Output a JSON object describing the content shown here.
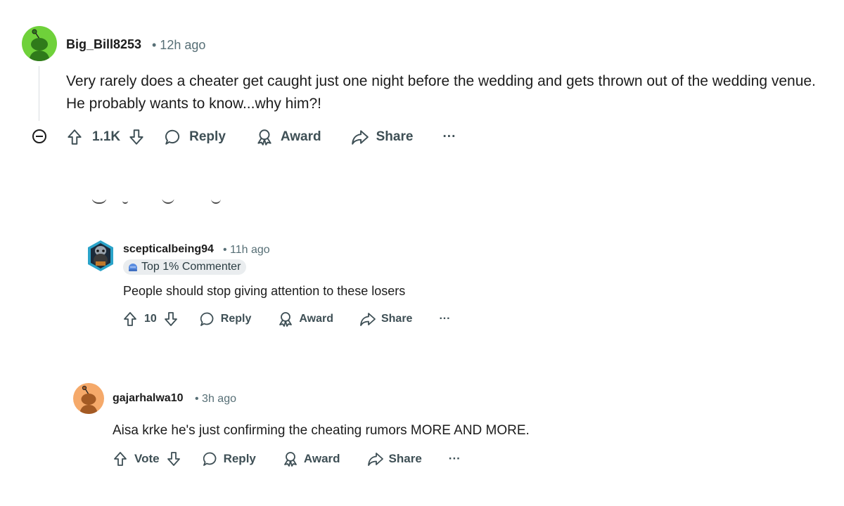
{
  "comments": [
    {
      "author": "Big_Bill8253",
      "time": "• 12h ago",
      "avatar_color": "#6fd13a",
      "body": "Very rarely does a cheater get caught just one night before the wedding and gets thrown out of the wedding venue. He probably wants to know...why him?!",
      "votes": "1.1K",
      "actions": {
        "reply": "Reply",
        "award": "Award",
        "share": "Share",
        "more": "···"
      },
      "icons": [
        "collapse-icon",
        "upvote-icon",
        "downvote-icon",
        "reply-icon",
        "award-icon",
        "share-icon",
        "more-icon"
      ]
    },
    {
      "author": "scepticalbeing94",
      "time": "• 11h ago",
      "flair": "Top 1% Commenter",
      "body": "People should stop giving attention to these losers",
      "votes": "10",
      "actions": {
        "reply": "Reply",
        "award": "Award",
        "share": "Share",
        "more": "···"
      }
    },
    {
      "author": "gajarhalwa10",
      "time": "• 3h ago",
      "avatar_color": "#f5a96a",
      "body": "Aisa krke he's just confirming the cheating rumors MORE AND MORE.",
      "votes": "Vote",
      "actions": {
        "reply": "Reply",
        "award": "Award",
        "share": "Share",
        "more": "···"
      }
    }
  ],
  "colors": {
    "text": "#1c1c1c",
    "meta": "#576f76",
    "action": "#3e4f55",
    "thread_line": "#d9dde0",
    "flair_bg": "#eaedef"
  }
}
